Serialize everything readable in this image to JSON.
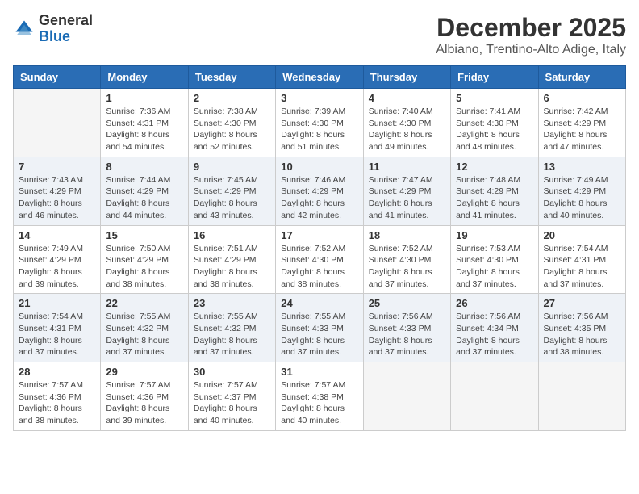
{
  "header": {
    "logo_general": "General",
    "logo_blue": "Blue",
    "month_title": "December 2025",
    "location": "Albiano, Trentino-Alto Adige, Italy"
  },
  "days_of_week": [
    "Sunday",
    "Monday",
    "Tuesday",
    "Wednesday",
    "Thursday",
    "Friday",
    "Saturday"
  ],
  "weeks": [
    [
      {
        "day": "",
        "info": ""
      },
      {
        "day": "1",
        "info": "Sunrise: 7:36 AM\nSunset: 4:31 PM\nDaylight: 8 hours\nand 54 minutes."
      },
      {
        "day": "2",
        "info": "Sunrise: 7:38 AM\nSunset: 4:30 PM\nDaylight: 8 hours\nand 52 minutes."
      },
      {
        "day": "3",
        "info": "Sunrise: 7:39 AM\nSunset: 4:30 PM\nDaylight: 8 hours\nand 51 minutes."
      },
      {
        "day": "4",
        "info": "Sunrise: 7:40 AM\nSunset: 4:30 PM\nDaylight: 8 hours\nand 49 minutes."
      },
      {
        "day": "5",
        "info": "Sunrise: 7:41 AM\nSunset: 4:30 PM\nDaylight: 8 hours\nand 48 minutes."
      },
      {
        "day": "6",
        "info": "Sunrise: 7:42 AM\nSunset: 4:29 PM\nDaylight: 8 hours\nand 47 minutes."
      }
    ],
    [
      {
        "day": "7",
        "info": "Sunrise: 7:43 AM\nSunset: 4:29 PM\nDaylight: 8 hours\nand 46 minutes."
      },
      {
        "day": "8",
        "info": "Sunrise: 7:44 AM\nSunset: 4:29 PM\nDaylight: 8 hours\nand 44 minutes."
      },
      {
        "day": "9",
        "info": "Sunrise: 7:45 AM\nSunset: 4:29 PM\nDaylight: 8 hours\nand 43 minutes."
      },
      {
        "day": "10",
        "info": "Sunrise: 7:46 AM\nSunset: 4:29 PM\nDaylight: 8 hours\nand 42 minutes."
      },
      {
        "day": "11",
        "info": "Sunrise: 7:47 AM\nSunset: 4:29 PM\nDaylight: 8 hours\nand 41 minutes."
      },
      {
        "day": "12",
        "info": "Sunrise: 7:48 AM\nSunset: 4:29 PM\nDaylight: 8 hours\nand 41 minutes."
      },
      {
        "day": "13",
        "info": "Sunrise: 7:49 AM\nSunset: 4:29 PM\nDaylight: 8 hours\nand 40 minutes."
      }
    ],
    [
      {
        "day": "14",
        "info": "Sunrise: 7:49 AM\nSunset: 4:29 PM\nDaylight: 8 hours\nand 39 minutes."
      },
      {
        "day": "15",
        "info": "Sunrise: 7:50 AM\nSunset: 4:29 PM\nDaylight: 8 hours\nand 38 minutes."
      },
      {
        "day": "16",
        "info": "Sunrise: 7:51 AM\nSunset: 4:29 PM\nDaylight: 8 hours\nand 38 minutes."
      },
      {
        "day": "17",
        "info": "Sunrise: 7:52 AM\nSunset: 4:30 PM\nDaylight: 8 hours\nand 38 minutes."
      },
      {
        "day": "18",
        "info": "Sunrise: 7:52 AM\nSunset: 4:30 PM\nDaylight: 8 hours\nand 37 minutes."
      },
      {
        "day": "19",
        "info": "Sunrise: 7:53 AM\nSunset: 4:30 PM\nDaylight: 8 hours\nand 37 minutes."
      },
      {
        "day": "20",
        "info": "Sunrise: 7:54 AM\nSunset: 4:31 PM\nDaylight: 8 hours\nand 37 minutes."
      }
    ],
    [
      {
        "day": "21",
        "info": "Sunrise: 7:54 AM\nSunset: 4:31 PM\nDaylight: 8 hours\nand 37 minutes."
      },
      {
        "day": "22",
        "info": "Sunrise: 7:55 AM\nSunset: 4:32 PM\nDaylight: 8 hours\nand 37 minutes."
      },
      {
        "day": "23",
        "info": "Sunrise: 7:55 AM\nSunset: 4:32 PM\nDaylight: 8 hours\nand 37 minutes."
      },
      {
        "day": "24",
        "info": "Sunrise: 7:55 AM\nSunset: 4:33 PM\nDaylight: 8 hours\nand 37 minutes."
      },
      {
        "day": "25",
        "info": "Sunrise: 7:56 AM\nSunset: 4:33 PM\nDaylight: 8 hours\nand 37 minutes."
      },
      {
        "day": "26",
        "info": "Sunrise: 7:56 AM\nSunset: 4:34 PM\nDaylight: 8 hours\nand 37 minutes."
      },
      {
        "day": "27",
        "info": "Sunrise: 7:56 AM\nSunset: 4:35 PM\nDaylight: 8 hours\nand 38 minutes."
      }
    ],
    [
      {
        "day": "28",
        "info": "Sunrise: 7:57 AM\nSunset: 4:36 PM\nDaylight: 8 hours\nand 38 minutes."
      },
      {
        "day": "29",
        "info": "Sunrise: 7:57 AM\nSunset: 4:36 PM\nDaylight: 8 hours\nand 39 minutes."
      },
      {
        "day": "30",
        "info": "Sunrise: 7:57 AM\nSunset: 4:37 PM\nDaylight: 8 hours\nand 40 minutes."
      },
      {
        "day": "31",
        "info": "Sunrise: 7:57 AM\nSunset: 4:38 PM\nDaylight: 8 hours\nand 40 minutes."
      },
      {
        "day": "",
        "info": ""
      },
      {
        "day": "",
        "info": ""
      },
      {
        "day": "",
        "info": ""
      }
    ]
  ]
}
